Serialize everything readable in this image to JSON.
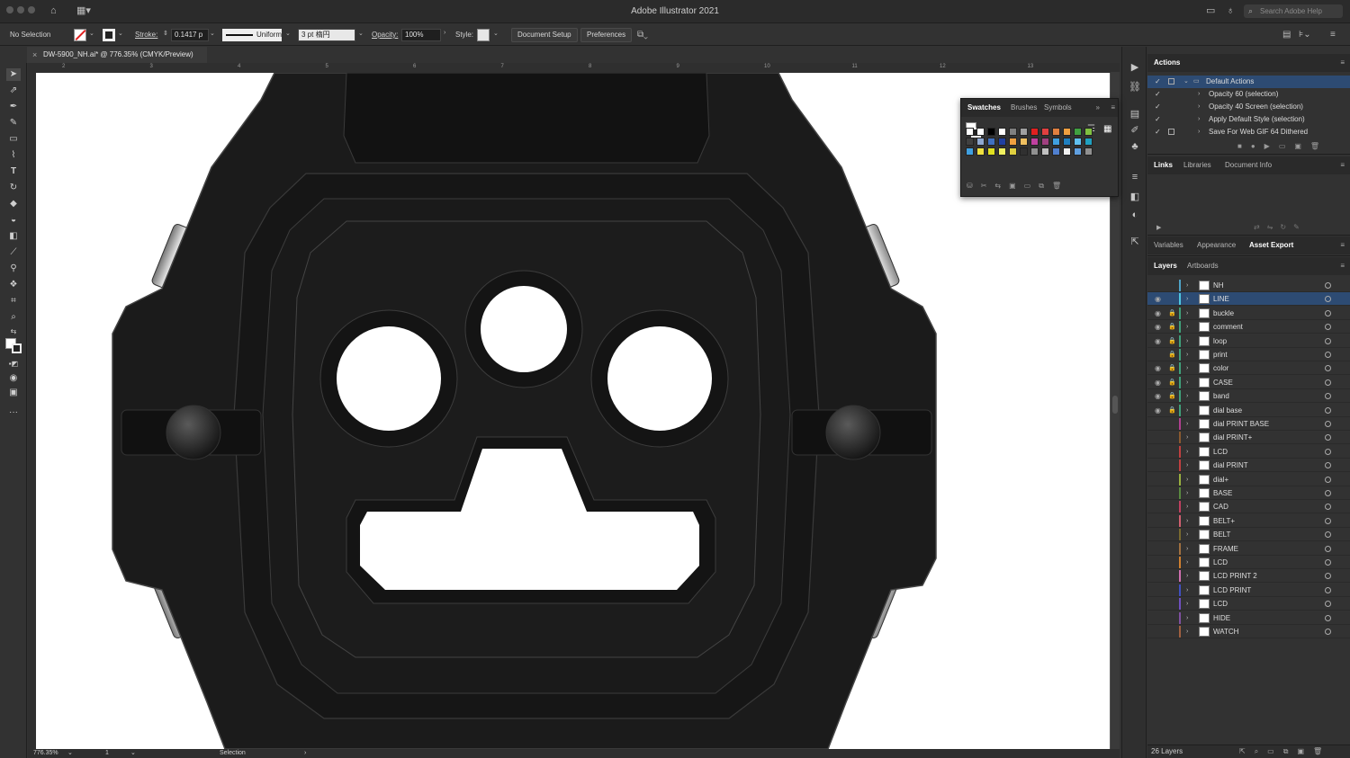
{
  "window": {
    "title": "Adobe Illustrator 2021",
    "search_placeholder": "Search Adobe Help"
  },
  "control_bar": {
    "selection_label": "No Selection",
    "stroke_label": "Stroke:",
    "stroke_value": "0.1417 p",
    "profile": "Uniform",
    "brush": "3 pt 楕円",
    "opacity_label": "Opacity:",
    "opacity_value": "100%",
    "style_label": "Style:",
    "document_setup": "Document Setup",
    "preferences": "Preferences"
  },
  "document": {
    "tab_title": "DW-5900_NH.ai* @ 776.35% (CMYK/Preview)",
    "close_glyph": "×"
  },
  "ruler_numbers": [
    "2",
    "3",
    "4",
    "5",
    "6",
    "7",
    "8",
    "9",
    "10",
    "11",
    "12",
    "13"
  ],
  "status_bar": {
    "zoom": "776.35%",
    "artboard_number": "1",
    "tool_name": "Selection"
  },
  "panels": {
    "actions": {
      "tab": "Actions",
      "rows": [
        {
          "label": "Default Actions",
          "folder": true,
          "selected": true
        },
        {
          "label": "Opacity 60 (selection)"
        },
        {
          "label": "Opacity 40 Screen (selection)"
        },
        {
          "label": "Apply Default Style (selection)"
        },
        {
          "label": "Save For Web GIF 64 Dithered"
        }
      ]
    },
    "links_tabs": [
      "Links",
      "Libraries",
      "Document Info"
    ],
    "appearance_tabs": [
      "Variables",
      "Appearance",
      "Asset Export"
    ],
    "layers_tabs": [
      "Layers",
      "Artboards"
    ],
    "layers": [
      {
        "name": "NH",
        "color": "#4fa3c7",
        "visible": false,
        "locked": false,
        "selected": false
      },
      {
        "name": "LINE",
        "color": "#4fc7e0",
        "visible": true,
        "locked": false,
        "selected": true
      },
      {
        "name": "buckle",
        "color": "#3fa07a",
        "visible": true,
        "locked": true,
        "selected": false
      },
      {
        "name": "comment",
        "color": "#3fa07a",
        "visible": true,
        "locked": true,
        "selected": false
      },
      {
        "name": "loop",
        "color": "#3fa07a",
        "visible": true,
        "locked": true,
        "selected": false
      },
      {
        "name": "print",
        "color": "#3fa07a",
        "visible": false,
        "locked": true,
        "selected": false
      },
      {
        "name": "color",
        "color": "#3fa07a",
        "visible": true,
        "locked": true,
        "selected": false
      },
      {
        "name": "CASE",
        "color": "#3fa07a",
        "visible": true,
        "locked": true,
        "selected": false
      },
      {
        "name": "band",
        "color": "#3fa07a",
        "visible": true,
        "locked": true,
        "selected": false
      },
      {
        "name": "dial base",
        "color": "#3fa07a",
        "visible": true,
        "locked": true,
        "selected": false
      },
      {
        "name": "dial PRINT BASE",
        "color": "#b04090",
        "visible": false,
        "locked": false,
        "selected": false
      },
      {
        "name": "dial PRINT+",
        "color": "#8a5a30",
        "visible": false,
        "locked": false,
        "selected": false
      },
      {
        "name": "LCD",
        "color": "#c04040",
        "visible": false,
        "locked": false,
        "selected": false
      },
      {
        "name": "dial PRINT",
        "color": "#c04040",
        "visible": false,
        "locked": false,
        "selected": false
      },
      {
        "name": "dial+",
        "color": "#9ab040",
        "visible": false,
        "locked": false,
        "selected": false
      },
      {
        "name": "BASE",
        "color": "#5a8a40",
        "visible": false,
        "locked": false,
        "selected": false
      },
      {
        "name": "CAD",
        "color": "#c04060",
        "visible": false,
        "locked": false,
        "selected": false
      },
      {
        "name": "BELT+",
        "color": "#d06070",
        "visible": false,
        "locked": false,
        "selected": false
      },
      {
        "name": "BELT",
        "color": "#7a6a30",
        "visible": false,
        "locked": false,
        "selected": false
      },
      {
        "name": "FRAME",
        "color": "#a07040",
        "visible": false,
        "locked": false,
        "selected": false
      },
      {
        "name": "LCD",
        "color": "#d08030",
        "visible": false,
        "locked": false,
        "selected": false
      },
      {
        "name": "LCD PRINT 2",
        "color": "#d070b0",
        "visible": false,
        "locked": false,
        "selected": false
      },
      {
        "name": "LCD PRINT",
        "color": "#4050c0",
        "visible": false,
        "locked": false,
        "selected": false
      },
      {
        "name": "LCD",
        "color": "#7050c0",
        "visible": false,
        "locked": false,
        "selected": false
      },
      {
        "name": "HIDE",
        "color": "#8050a0",
        "visible": false,
        "locked": false,
        "selected": false
      },
      {
        "name": "WATCH",
        "color": "#a06040",
        "visible": false,
        "locked": false,
        "selected": false
      }
    ],
    "layers_footer": "26 Layers",
    "swatches_tabs": [
      "Swatches",
      "Brushes",
      "Symbols"
    ]
  },
  "swatch_colors": [
    "#ffffff",
    "#ffffff",
    "#000000",
    "#ffffff",
    "#808080",
    "#a0a0a0",
    "#e02020",
    "#e04040",
    "#e08040",
    "#f0a040",
    "#40a040",
    "#80c040",
    "#404040",
    "#8fa8d0",
    "#4070c0",
    "#2040a0",
    "#f0a040",
    "#f0c060",
    "#c040a0",
    "#a04080",
    "#40a0e0",
    "#2080c0",
    "#60c0f0",
    "#20a0c0",
    "#40a0e0",
    "#f0e040",
    "#e0e020",
    "#f0f060",
    "#e0d040",
    "#303030",
    "#909090",
    "#c0c0c0",
    "#5080d0",
    "#f0f0f0",
    "#60a0e0",
    "#909090"
  ]
}
